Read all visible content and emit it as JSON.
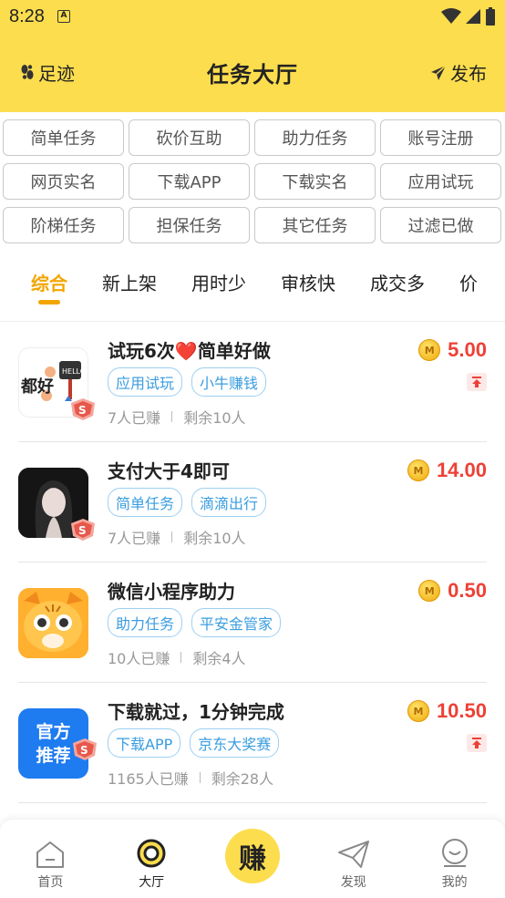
{
  "status": {
    "time": "8:28",
    "sim_icon": "A"
  },
  "header": {
    "left_label": "足迹",
    "title": "任务大厅",
    "right_label": "发布"
  },
  "filters": [
    "简单任务",
    "砍价互助",
    "助力任务",
    "账号注册",
    "网页实名",
    "下载APP",
    "下载实名",
    "应用试玩",
    "阶梯任务",
    "担保任务",
    "其它任务",
    "过滤已做"
  ],
  "sorts": [
    "综合",
    "新上架",
    "用时少",
    "审核快",
    "成交多",
    "价"
  ],
  "tasks": [
    {
      "name": "试玩6次❤️简单好做",
      "tags": [
        "应用试玩",
        "小牛赚钱"
      ],
      "earned": "7人已赚",
      "remaining": "剩余10人",
      "amount": "5.00",
      "pinned": true,
      "thumb": "都好"
    },
    {
      "name": "支付大于4即可",
      "tags": [
        "简单任务",
        "滴滴出行"
      ],
      "earned": "7人已赚",
      "remaining": "剩余10人",
      "amount": "14.00",
      "pinned": false,
      "thumb": ""
    },
    {
      "name": "微信小程序助力",
      "tags": [
        "助力任务",
        "平安金管家"
      ],
      "earned": "10人已赚",
      "remaining": "剩余4人",
      "amount": "0.50",
      "pinned": false,
      "thumb": ""
    },
    {
      "name": "下载就过，1分钟完成",
      "tags": [
        "下载APP",
        "京东大奖赛"
      ],
      "earned": "1165人已赚",
      "remaining": "剩余28人",
      "amount": "10.50",
      "pinned": true,
      "thumb": "官方推荐"
    }
  ],
  "coin_letter": "M",
  "nav": {
    "home": "首页",
    "hall": "大厅",
    "earn": "赚",
    "discover": "发现",
    "mine": "我的"
  },
  "colors": {
    "brand": "#FCDD4E",
    "accent": "#F2A500",
    "price": "#EE4035",
    "tag": "#3a9de0"
  }
}
